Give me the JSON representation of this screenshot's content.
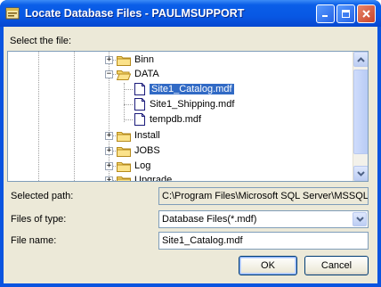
{
  "window": {
    "title": "Locate Database Files - PAULMSUPPORT"
  },
  "labels": {
    "select_file": "Select the file:",
    "selected_path": "Selected path:",
    "files_of_type": "Files of type:",
    "file_name": "File name:"
  },
  "tree": {
    "items": [
      {
        "label": "Binn",
        "kind": "folder",
        "expander": "+"
      },
      {
        "label": "DATA",
        "kind": "folder-open",
        "expander": "−"
      },
      {
        "label": "Site1_Catalog.mdf",
        "kind": "file",
        "selected": true
      },
      {
        "label": "Site1_Shipping.mdf",
        "kind": "file"
      },
      {
        "label": "tempdb.mdf",
        "kind": "file"
      },
      {
        "label": "Install",
        "kind": "folder",
        "expander": "+"
      },
      {
        "label": "JOBS",
        "kind": "folder",
        "expander": "+"
      },
      {
        "label": "Log",
        "kind": "folder",
        "expander": "+"
      },
      {
        "label": "Upgrade",
        "kind": "folder",
        "expander": "+"
      }
    ]
  },
  "fields": {
    "selected_path": "C:\\Program Files\\Microsoft SQL Server\\MSSQL",
    "files_of_type": "Database Files(*.mdf)",
    "file_name": "Site1_Catalog.mdf"
  },
  "buttons": {
    "ok": "OK",
    "cancel": "Cancel"
  },
  "colors": {
    "titlebar": "#0a5ee8",
    "selection": "#316ac5",
    "dialog_face": "#ece9d8"
  },
  "icons": {
    "app": "database-app-icon",
    "minimize": "minimize-icon",
    "maximize": "maximize-icon",
    "close": "close-icon",
    "folder": "folder-icon",
    "file": "file-icon"
  }
}
